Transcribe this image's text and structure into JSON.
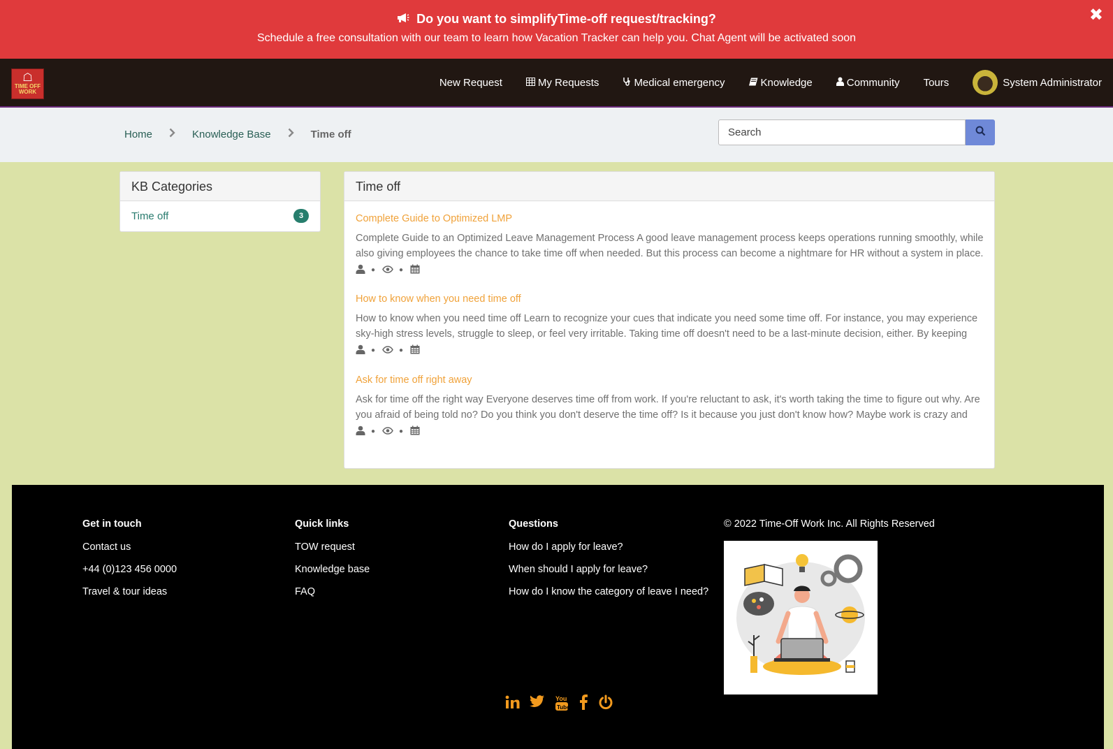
{
  "banner": {
    "title": "Do you want to simplifyTime-off request/tracking?",
    "subtitle": "Schedule a free consultation with our team to learn how Vacation Tracker can help you. Chat Agent will be activated soon",
    "close_label": "✖"
  },
  "logo": {
    "mark": "☖",
    "line1": "TIME OFF",
    "line2": "WORK"
  },
  "nav": {
    "new_request": "New Request",
    "my_requests": "My Requests",
    "medical": "Medical emergency",
    "knowledge": "Knowledge",
    "community": "Community",
    "tours": "Tours",
    "user": "System Administrator"
  },
  "breadcrumb": {
    "home": "Home",
    "kb": "Knowledge Base",
    "current": "Time off"
  },
  "search": {
    "placeholder": "Search"
  },
  "categories": {
    "heading": "KB Categories",
    "items": [
      {
        "label": "Time off",
        "count": "3"
      }
    ]
  },
  "main": {
    "heading": "Time off",
    "articles": [
      {
        "title": "Complete Guide to Optimized LMP",
        "excerpt": "Complete Guide to an Optimized Leave Management Process A good leave management process keeps operations running smoothly, while also giving employees the chance to take time off when needed. But this process can become a nightmare for HR without a system in place."
      },
      {
        "title": "How to know when you need time off",
        "excerpt": "How to know when you need time off    Learn to recognize your cues that indicate you need some time off. For instance, you may experience sky-high stress levels, struggle to sleep, or feel very irritable. Taking time off doesn't need to be a last-minute decision, either. By keeping"
      },
      {
        "title": "Ask for time off right away",
        "excerpt": "Ask for time off the right way  Everyone deserves time off from work. If you're reluctant to ask, it's worth taking the time to figure out why. Are you afraid of being told no? Do you think you don't deserve the time off? Is it because you just don't know how? Maybe work is crazy and"
      }
    ]
  },
  "footer": {
    "get_in_touch": {
      "heading": "Get in touch",
      "links": [
        "Contact us",
        "+44 (0)123 456 0000",
        "Travel & tour ideas"
      ]
    },
    "quick_links": {
      "heading": "Quick links",
      "links": [
        "TOW request",
        "Knowledge base",
        "FAQ"
      ]
    },
    "questions": {
      "heading": "Questions",
      "links": [
        "How do I apply for leave?",
        "When should I apply for leave?",
        "How do I know the category of leave I need?"
      ]
    },
    "copyright": "© 2022 Time-Off Work Inc. All Rights Reserved",
    "social": [
      "linkedin-icon",
      "twitter-icon",
      "youtube-icon",
      "facebook-icon",
      "power-icon"
    ]
  },
  "colors": {
    "banner": "#e03a3c",
    "navbar": "#211712",
    "page_bg": "#dbe2a7",
    "article_title": "#f0a23a",
    "badge": "#277e6d",
    "search_button": "#6f89d8",
    "social_icons": "#f29a1e"
  }
}
